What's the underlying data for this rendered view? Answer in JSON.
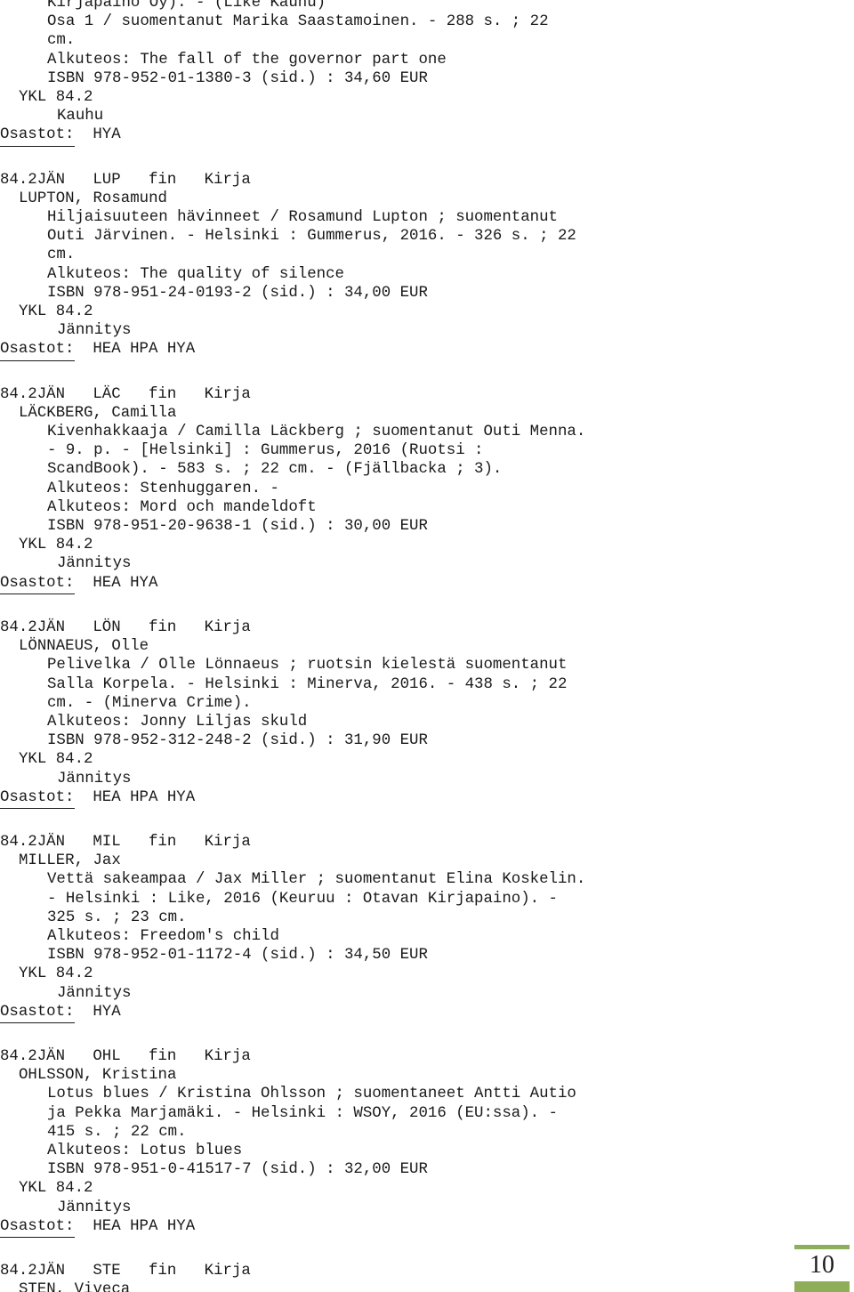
{
  "page": {
    "folio": "10",
    "accent_color": "#8FAE5A"
  },
  "labels": {
    "ykl": "YKL 84.2",
    "osastot": "Osastot:"
  },
  "entries": [
    {
      "header": null,
      "author": null,
      "continuation": [
        "Kirjapaino Oy). - (Like Kauhu)",
        "Osa 1 / suomentanut Marika Saastamoinen. - 288 s. ; 22",
        "cm.",
        "Alkuteos: The fall of the governor part one",
        "ISBN 978-952-01-1380-3 (sid.) : 34,60 EUR"
      ],
      "ykl": "YKL 84.2",
      "genre": "Kauhu",
      "osastot_label": "Osastot:",
      "osastot_value": "HYA"
    },
    {
      "header": "84.2JÄN   LUP   fin   Kirja",
      "author": "LUPTON, Rosamund",
      "continuation": [
        "Hiljaisuuteen hävinneet / Rosamund Lupton ; suomentanut",
        "Outi Järvinen. - Helsinki : Gummerus, 2016. - 326 s. ; 22",
        "cm.",
        "Alkuteos: The quality of silence",
        "ISBN 978-951-24-0193-2 (sid.) : 34,00 EUR"
      ],
      "ykl": "YKL 84.2",
      "genre": "Jännitys",
      "osastot_label": "Osastot:",
      "osastot_value": "HEA HPA HYA"
    },
    {
      "header": "84.2JÄN   LÄC   fin   Kirja",
      "author": "LÄCKBERG, Camilla",
      "continuation": [
        "Kivenhakkaaja / Camilla Läckberg ; suomentanut Outi Menna.",
        "- 9. p. - [Helsinki] : Gummerus, 2016 (Ruotsi :",
        "ScandBook). - 583 s. ; 22 cm. - (Fjällbacka ; 3).",
        "Alkuteos: Stenhuggaren. -",
        "Alkuteos: Mord och mandeldoft",
        "ISBN 978-951-20-9638-1 (sid.) : 30,00 EUR"
      ],
      "ykl": "YKL 84.2",
      "genre": "Jännitys",
      "osastot_label": "Osastot:",
      "osastot_value": "HEA HYA"
    },
    {
      "header": "84.2JÄN   LÖN   fin   Kirja",
      "author": "LÖNNAEUS, Olle",
      "continuation": [
        "Pelivelka / Olle Lönnaeus ; ruotsin kielestä suomentanut",
        "Salla Korpela. - Helsinki : Minerva, 2016. - 438 s. ; 22",
        "cm. - (Minerva Crime).",
        "Alkuteos: Jonny Liljas skuld",
        "ISBN 978-952-312-248-2 (sid.) : 31,90 EUR"
      ],
      "ykl": "YKL 84.2",
      "genre": "Jännitys",
      "osastot_label": "Osastot:",
      "osastot_value": "HEA HPA HYA"
    },
    {
      "header": "84.2JÄN   MIL   fin   Kirja",
      "author": "MILLER, Jax",
      "continuation": [
        "Vettä sakeampaa / Jax Miller ; suomentanut Elina Koskelin.",
        "- Helsinki : Like, 2016 (Keuruu : Otavan Kirjapaino). -",
        "325 s. ; 23 cm.",
        "Alkuteos: Freedom's child",
        "ISBN 978-952-01-1172-4 (sid.) : 34,50 EUR"
      ],
      "ykl": "YKL 84.2",
      "genre": "Jännitys",
      "osastot_label": "Osastot:",
      "osastot_value": "HYA"
    },
    {
      "header": "84.2JÄN   OHL   fin   Kirja",
      "author": "OHLSSON, Kristina",
      "continuation": [
        "Lotus blues / Kristina Ohlsson ; suomentaneet Antti Autio",
        "ja Pekka Marjamäki. - Helsinki : WSOY, 2016 (EU:ssa). -",
        "415 s. ; 22 cm.",
        "Alkuteos: Lotus blues",
        "ISBN 978-951-0-41517-7 (sid.) : 32,00 EUR"
      ],
      "ykl": "YKL 84.2",
      "genre": "Jännitys",
      "osastot_label": "Osastot:",
      "osastot_value": "HEA HPA HYA"
    },
    {
      "header": "84.2JÄN   STE   fin   Kirja",
      "author": "STEN, Viveca",
      "continuation": [],
      "ykl": null,
      "genre": null,
      "osastot_label": null,
      "osastot_value": null
    }
  ]
}
